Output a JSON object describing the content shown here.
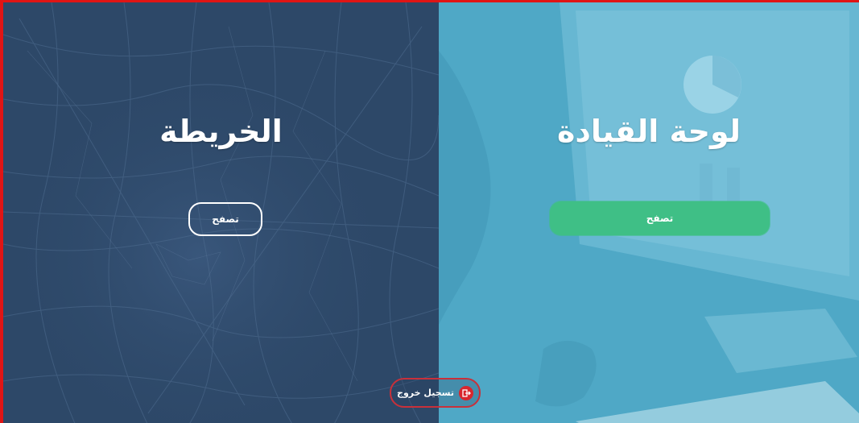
{
  "map_panel": {
    "title": "الخريطة",
    "browse_label": "تصفح"
  },
  "dashboard_panel": {
    "title": "لوحة القيادة",
    "browse_label": "تصفح"
  },
  "logout": {
    "label": "تسجيل خروج",
    "icon": "logout-icon"
  },
  "colors": {
    "map_overlay": "#2b4666",
    "dashboard_overlay": "#4fa8c6",
    "browse_filled": "#3fbf86",
    "logout_accent": "#d8262e",
    "frame_border": "#e01515"
  }
}
